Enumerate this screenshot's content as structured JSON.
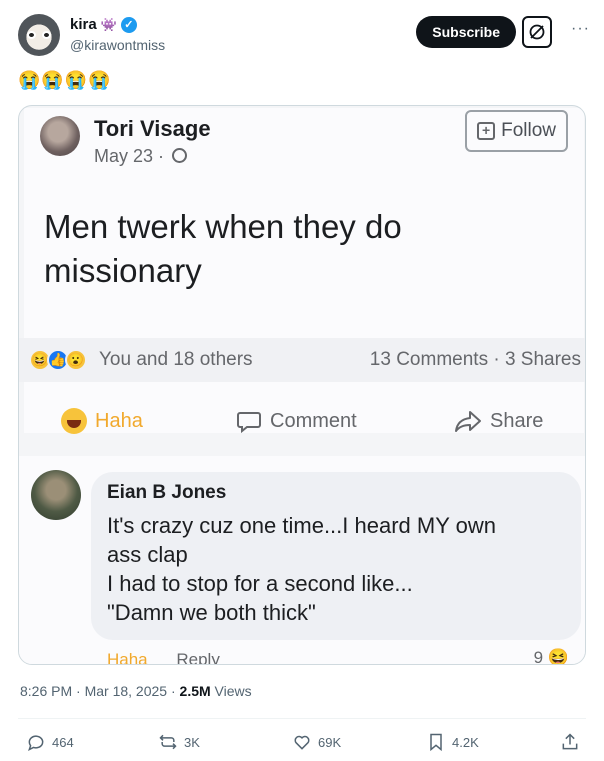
{
  "tweet": {
    "author_name": "kira",
    "name_badge": "👾",
    "handle": "@kirawontmiss",
    "subscribe_label": "Subscribe",
    "text": "😭😭😭😭",
    "timestamp": "8:26 PM · Mar 18, 2025 · ",
    "views_count": "2.5M",
    "views_label": " Views"
  },
  "embedded_post": {
    "author": "Tori Visage",
    "date": "May 23 ·",
    "follow_label": "Follow",
    "body": "Men twerk when they do missionary",
    "reactions_text": "You and 18 others",
    "comments_shares": "13 Comments · 3 Shares",
    "actions": {
      "haha": "Haha",
      "comment": "Comment",
      "share": "Share"
    },
    "comment": {
      "author": "Eian B Jones",
      "text": "It's crazy cuz one time...I heard MY own\nass clap\nI had to stop for a second like...\n\"Damn we both thick\"",
      "haha_label": "Haha",
      "reply_label": "Reply",
      "reaction_count": "9"
    }
  },
  "actions": {
    "replies": "464",
    "reposts": "3K",
    "likes": "69K",
    "bookmarks": "4.2K"
  },
  "icons": {
    "verified": "verified-badge-icon",
    "grok": "grok-icon",
    "more": "more-icon",
    "reply": "reply-icon",
    "repost": "repost-icon",
    "like": "heart-icon",
    "bookmark": "bookmark-icon",
    "share": "share-icon"
  },
  "colors": {
    "verified": "#1d9bf0",
    "text": "#0f1419",
    "muted": "#536471",
    "haha": "#f1a92d"
  }
}
